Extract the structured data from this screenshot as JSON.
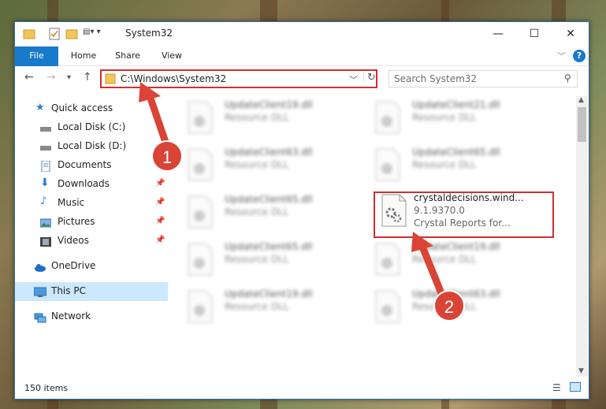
{
  "window": {
    "title": "System32"
  },
  "ribbon": {
    "tabs": [
      "File",
      "Home",
      "Share",
      "View"
    ]
  },
  "address": {
    "path": "C:\\Windows\\System32"
  },
  "search": {
    "placeholder": "Search System32"
  },
  "sidebar": {
    "items": [
      {
        "label": "Quick access",
        "icon": "star-icon"
      },
      {
        "label": "Local Disk (C:)",
        "icon": "drive-icon"
      },
      {
        "label": "Local Disk (D:)",
        "icon": "drive-icon"
      },
      {
        "label": "Documents",
        "icon": "documents-icon"
      },
      {
        "label": "Downloads",
        "icon": "download-icon"
      },
      {
        "label": "Music",
        "icon": "music-icon"
      },
      {
        "label": "Pictures",
        "icon": "pictures-icon"
      },
      {
        "label": "Videos",
        "icon": "videos-icon"
      },
      {
        "label": "OneDrive",
        "icon": "cloud-icon"
      },
      {
        "label": "This PC",
        "icon": "computer-icon"
      },
      {
        "label": "Network",
        "icon": "network-icon"
      }
    ]
  },
  "files": [
    {
      "name": "UpdateClient19.dll",
      "sub": "Resource DLL"
    },
    {
      "name": "UpdateClient21.dll",
      "sub": "Resource DLL"
    },
    {
      "name": "UpdateClient63.dll",
      "sub": "Resource DLL"
    },
    {
      "name": "UpdateClient65.dll",
      "sub": "Resource DLL"
    },
    {
      "name": "UpdateClient65.dll",
      "sub": "Resource DLL"
    },
    {
      "name": "crystaldecisions.wind...",
      "version": "9.1.9370.0",
      "sub": "Crystal Reports for..."
    },
    {
      "name": "UpdateClient65.dll",
      "sub": "Resource DLL"
    },
    {
      "name": "UpdateClient19.dll",
      "sub": "Resource DLL"
    },
    {
      "name": "UpdateClient19.dll",
      "sub": "Resource DLL"
    },
    {
      "name": "UpdateClient63.dll",
      "sub": "Resource DLL"
    }
  ],
  "status": {
    "count": "150 items"
  },
  "badges": {
    "one": "1",
    "two": "2"
  },
  "colors": {
    "accent": "#1979ca",
    "highlight": "#d12e2e"
  }
}
